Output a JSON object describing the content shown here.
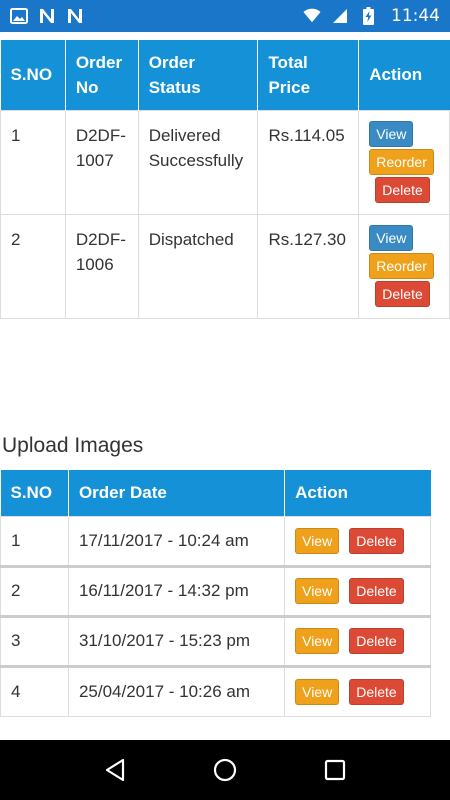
{
  "status_bar": {
    "time": "11:44",
    "icons": [
      "image-icon",
      "n-app-icon",
      "n-app-icon",
      "wifi-icon",
      "signal-icon",
      "battery-charging-icon"
    ]
  },
  "orders_table": {
    "headers": {
      "sno": "S.NO",
      "order_no": "Order No",
      "order_status": "Order Status",
      "total_price": "Total Price",
      "action": "Action"
    },
    "rows": [
      {
        "sno": "1",
        "order_no": "D2DF-1007",
        "status": "Delivered Successfully",
        "price": "Rs.114.05",
        "view": "View",
        "reorder": "Reorder",
        "delete": "Delete"
      },
      {
        "sno": "2",
        "order_no": "D2DF-1006",
        "status": "Dispatched",
        "price": "Rs.127.30",
        "view": "View",
        "reorder": "Reorder",
        "delete": "Delete"
      }
    ]
  },
  "upload_images": {
    "title": "Upload Images",
    "headers": {
      "sno": "S.NO",
      "order_date": "Order Date",
      "action": "Action"
    },
    "rows": [
      {
        "sno": "1",
        "date": "17/11/2017 - 10:24 am",
        "view": "View",
        "delete": "Delete"
      },
      {
        "sno": "2",
        "date": "16/11/2017 - 14:32 pm",
        "view": "View",
        "delete": "Delete"
      },
      {
        "sno": "3",
        "date": "31/10/2017 - 15:23 pm",
        "view": "View",
        "delete": "Delete"
      },
      {
        "sno": "4",
        "date": "25/04/2017 - 10:26 am",
        "view": "View",
        "delete": "Delete"
      }
    ]
  },
  "colors": {
    "status_bar": "#1976c8",
    "table_header": "#1592d7",
    "view_blue": "#3a8bc4",
    "orange": "#f0a11b",
    "delete_red": "#dc4a35"
  },
  "nav_bar": {
    "icons": [
      "back-icon",
      "home-icon",
      "recents-icon"
    ]
  }
}
